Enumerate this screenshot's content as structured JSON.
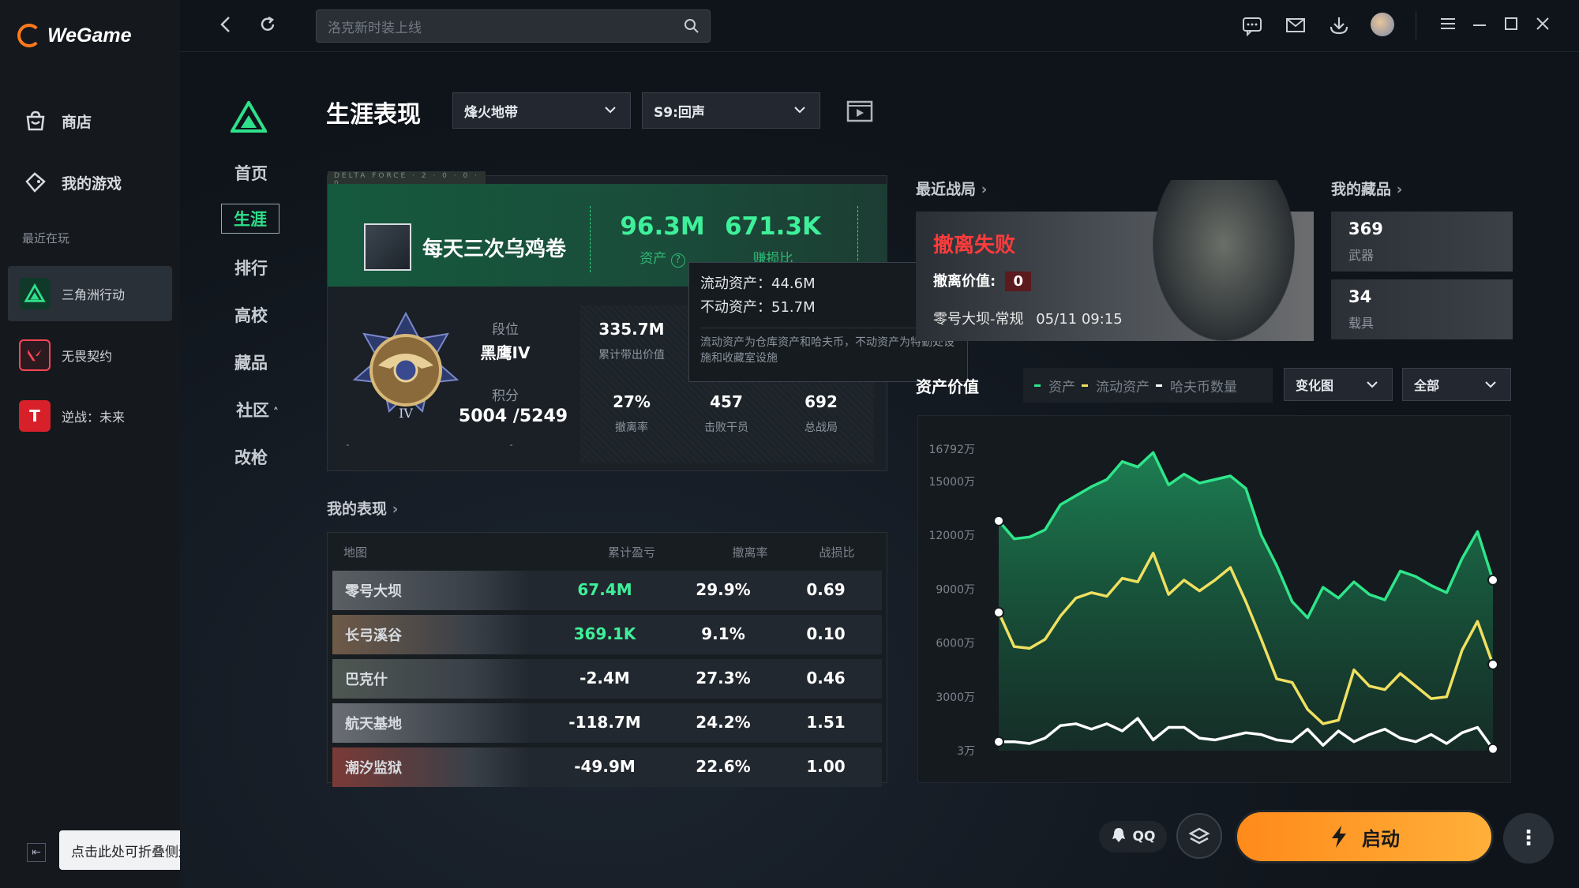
{
  "app": {
    "name": "WeGame"
  },
  "sidebar": {
    "items": [
      {
        "label": "商店",
        "icon": "store-icon"
      },
      {
        "label": "我的游戏",
        "icon": "gamepad-icon"
      }
    ],
    "recent_label": "最近在玩",
    "games": [
      {
        "label": "三角洲行动",
        "active": true
      },
      {
        "label": "无畏契约",
        "active": false
      },
      {
        "label": "逆战：未来",
        "active": false
      }
    ],
    "collapse_tip": "点击此处可折叠侧边栏"
  },
  "topbar": {
    "search_placeholder": "洛克新时装上线"
  },
  "subnav": [
    "首页",
    "生涯",
    "排行",
    "高校",
    "藏品",
    "社区",
    "改枪"
  ],
  "page": {
    "title": "生涯表现",
    "mode_select": "烽火地带",
    "season_select": "S9:回声"
  },
  "player": {
    "banner_tag": "DELTA FORCE · 2 · 0 · 0 · 0",
    "name": "每天三次乌鸡卷",
    "assets_value": "96.3M",
    "assets_label": "资产",
    "kd_value": "671.3K",
    "kd_label": "赚损比",
    "rank_label": "段位",
    "rank_value": "黑鹰IV",
    "score_label": "积分",
    "score_value": "5004 /5249",
    "rank_numeral": "IV",
    "stats": [
      {
        "value": "335.7M",
        "label": "累计带出价值"
      },
      {
        "value": "27%",
        "label": "撤离率"
      },
      {
        "value": "457",
        "label": "击败干员"
      },
      {
        "value": "692",
        "label": "总战局"
      }
    ]
  },
  "tooltip": {
    "line1": "流动资产：44.6M",
    "line2": "不动资产：51.7M",
    "desc": "流动资产为仓库资产和哈夫币，不动资产为特勤处设施和收藏室设施"
  },
  "performance": {
    "title": "我的表现",
    "headers": [
      "地图",
      "累计盈亏",
      "撤离率",
      "战损比"
    ],
    "rows": [
      {
        "map": "零号大坝",
        "profit": "67.4M",
        "rate": "29.9%",
        "ratio": "0.69",
        "positive": true
      },
      {
        "map": "长弓溪谷",
        "profit": "369.1K",
        "rate": "9.1%",
        "ratio": "0.10",
        "positive": true
      },
      {
        "map": "巴克什",
        "profit": "-2.4M",
        "rate": "27.3%",
        "ratio": "0.46",
        "positive": false
      },
      {
        "map": "航天基地",
        "profit": "-118.7M",
        "rate": "24.2%",
        "ratio": "1.51",
        "positive": false
      },
      {
        "map": "潮汐监狱",
        "profit": "-49.9M",
        "rate": "22.6%",
        "ratio": "1.00",
        "positive": false
      }
    ]
  },
  "recent": {
    "title": "最近战局",
    "result": "撤离失败",
    "value_label": "撤离价值:",
    "value": "0",
    "map": "零号大坝-常规",
    "time": "05/11 09:15"
  },
  "collection": {
    "title": "我的藏品",
    "items": [
      {
        "count": "369",
        "label": "武器"
      },
      {
        "count": "34",
        "label": "载具"
      }
    ]
  },
  "asset_chart": {
    "title": "资产价值",
    "legend": [
      "资产",
      "流动资产",
      "哈夫币数量"
    ],
    "view_select": "变化图",
    "range_select": "全部"
  },
  "chart_data": {
    "type": "area",
    "yticks": [
      "16792万",
      "15000万",
      "12000万",
      "9000万",
      "6000万",
      "3000万",
      "3万"
    ],
    "ytick_values": [
      16792,
      15000,
      12000,
      9000,
      6000,
      3000,
      3
    ],
    "ylim": [
      3,
      16792
    ],
    "series": [
      {
        "name": "资产",
        "color": "#2ee68a",
        "values": [
          12800,
          11800,
          11900,
          12300,
          13700,
          14200,
          14700,
          15100,
          16100,
          15800,
          16600,
          14800,
          15400,
          14900,
          15100,
          15300,
          14600,
          12000,
          10300,
          8300,
          7400,
          9100,
          8500,
          9400,
          8700,
          8400,
          10000,
          9700,
          9200,
          8800,
          10700,
          12200,
          9500
        ]
      },
      {
        "name": "流动资产",
        "color": "#f0e060",
        "values": [
          7700,
          5800,
          5700,
          6200,
          7500,
          8500,
          8800,
          8600,
          9600,
          9400,
          11000,
          8700,
          9500,
          8900,
          9500,
          10200,
          8300,
          6200,
          4000,
          3800,
          2300,
          1500,
          1700,
          4500,
          3600,
          3400,
          4300,
          3600,
          2900,
          3000,
          5600,
          7200,
          4800
        ]
      },
      {
        "name": "哈夫币数量",
        "color": "#ffffff",
        "values": [
          500,
          500,
          400,
          700,
          1400,
          1500,
          1200,
          1500,
          1100,
          1800,
          600,
          1300,
          1300,
          700,
          600,
          800,
          1000,
          900,
          600,
          500,
          1200,
          300,
          1100,
          500,
          900,
          1200,
          700,
          500,
          900,
          400,
          1000,
          1300,
          100
        ]
      }
    ]
  },
  "bottom": {
    "qq": "QQ",
    "start": "启动",
    "more": "⋮"
  },
  "colors": {
    "accent": "#2fe08a",
    "fail": "#ff3b3b",
    "start": "#ff9a22"
  }
}
